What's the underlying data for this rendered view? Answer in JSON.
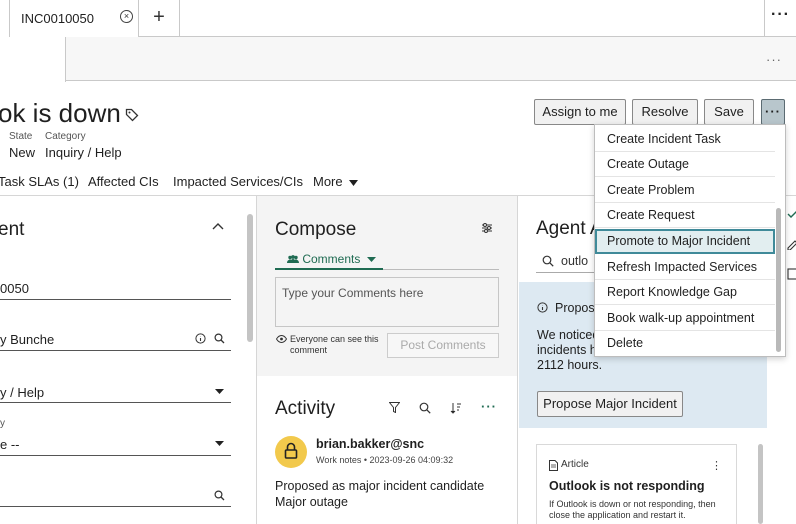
{
  "tabs": {
    "active_label": "INC0010050",
    "close_glyph": "×",
    "add_glyph": "+",
    "more_glyph": "···"
  },
  "subbar": {
    "more_glyph": "···"
  },
  "record": {
    "title": "ok is down",
    "state_label": "State",
    "state_value": "New",
    "category_label": "Category",
    "category_value": "Inquiry / Help"
  },
  "actions": {
    "assign": "Assign to me",
    "resolve": "Resolve",
    "save": "Save",
    "more": "···"
  },
  "related_tabs": {
    "task_slas": "Task SLAs (1)",
    "affected_cis": "Affected CIs",
    "impacted": "Impacted Services/CIs",
    "more": "More"
  },
  "left": {
    "heading": "ent",
    "number_value": "0050",
    "caller_value": "y Bunche",
    "category_value": "y / Help",
    "sub_label": "y",
    "sub_value": "e --"
  },
  "compose": {
    "heading": "Compose",
    "mode": "Comments",
    "placeholder": "Type your Comments here",
    "visibility": "Everyone can see this comment",
    "post": "Post Comments"
  },
  "activity": {
    "heading": "Activity",
    "more": "···",
    "user": "brian.bakker@snc",
    "meta": "Work notes • 2023-09-26 04:09:32",
    "body_line1": "Proposed as major incident candidate",
    "body_line2": "Major outage"
  },
  "agent": {
    "heading": "Agent A",
    "search_value": "outlo",
    "proposal_title": "Propos",
    "proposal_line1": "We noticed",
    "proposal_line2": "incidents h",
    "proposal_line3": "2112 hours.",
    "propose_btn": "Propose Major Incident",
    "article_type": "Article",
    "article_more": "⋮",
    "article_title": "Outlook is not responding",
    "article_body1": "If Outlook is down or not responding, then",
    "article_body2": "close the application and restart it."
  },
  "menu": {
    "items": [
      "Create Incident Task",
      "Create Outage",
      "Create Problem",
      "Create Request",
      "Promote to Major Incident",
      "Refresh Impacted Services",
      "Report Knowledge Gap",
      "Book walk-up appointment",
      "Delete"
    ],
    "selected_index": 4
  },
  "colors": {
    "accent_green": "#1f6b52",
    "menu_selected_border": "#3f8a99",
    "proposal_bg": "#dde9f2",
    "avatar_bg": "#f2c94c"
  }
}
